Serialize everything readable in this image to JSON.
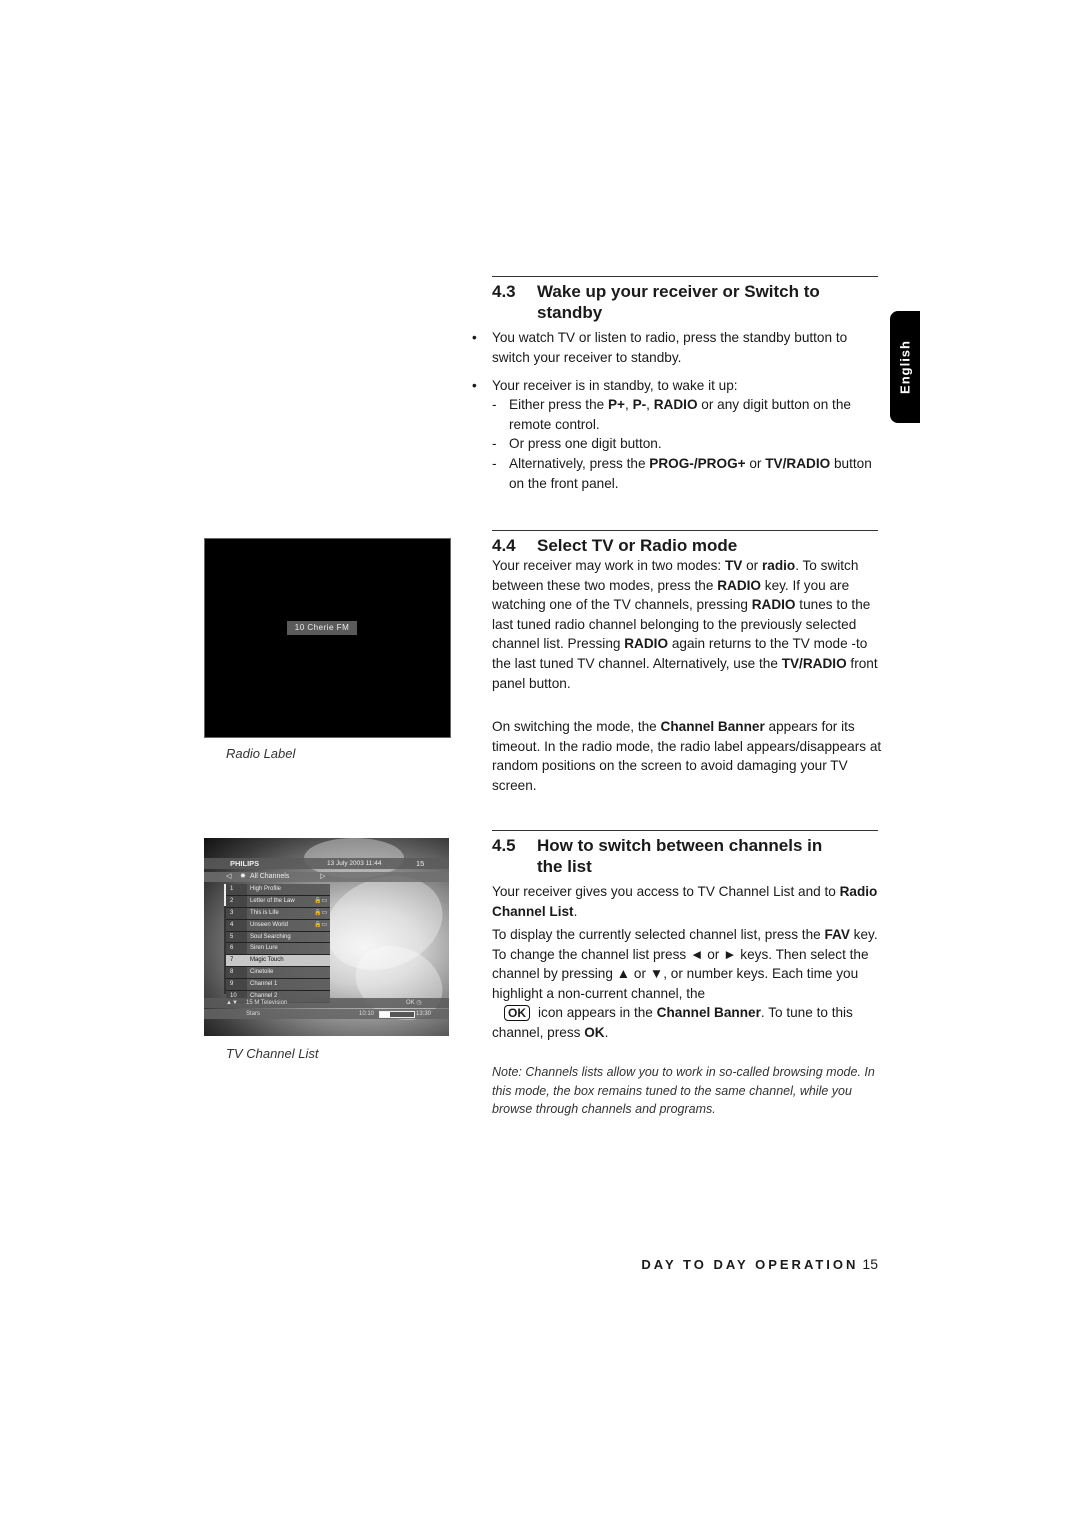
{
  "side_tab": {
    "language": "English"
  },
  "section_4_3": {
    "number": "4.3",
    "title_line1": "Wake up your receiver or Switch to",
    "title_line2": "standby",
    "bullet1": "You watch TV or listen to radio, press the standby button to switch your receiver to standby.",
    "bullet2": "Your receiver is in standby, to wake it up:",
    "dash1_pre": "Either press the ",
    "dash1_b1": "P+",
    "dash1_sep1": ", ",
    "dash1_b2": "P-",
    "dash1_sep2": ", ",
    "dash1_b3": "RADIO",
    "dash1_post": " or any digit button on the remote control.",
    "dash2": "Or press one digit button.",
    "dash3_pre": "Alternatively, press the ",
    "dash3_b1": "PROG-/PROG+",
    "dash3_mid": " or ",
    "dash3_b2": "TV/RADIO",
    "dash3_post": " button on the front panel."
  },
  "section_4_4": {
    "number": "4.4",
    "title": "Select TV or Radio mode",
    "p1_a": "Your receiver may work in two modes: ",
    "p1_b1": "TV",
    "p1_c": " or ",
    "p1_b2": "radio",
    "p1_d": ". To switch between these two modes, press the ",
    "p1_b3": "RADIO",
    "p1_e": " key. If you are watching one of the TV channels, pressing ",
    "p1_b4": "RADIO",
    "p1_f": " tunes to the last tuned radio channel belonging to the previously selected channel list. Pressing ",
    "p1_b5": "RADIO",
    "p1_g": " again returns to the TV mode -to the last tuned TV channel. Alternatively, use the ",
    "p1_b6": "TV/RADIO",
    "p1_h": " front panel button.",
    "p2_a": "On switching the mode, the ",
    "p2_b": "Channel Banner",
    "p2_c": " appears for its timeout. In the radio mode, the radio label appears/disappears at random positions on the screen to avoid damaging your TV screen."
  },
  "section_4_5": {
    "number": "4.5",
    "title_line1": "How to switch between channels in",
    "title_line2": "the list",
    "p1_a": "Your receiver gives you access to TV Channel List and to ",
    "p1_b": "Radio Channel List",
    "p1_c": ".",
    "p2_a": "To display the currently selected channel list, press the ",
    "p2_b1": "FAV",
    "p2_c": " key. To change the channel list press ◄  or ► keys. Then select the channel by pressing ▲ or ▼, or number keys. Each time you highlight a non-current channel, the",
    "ok_icon": "OK",
    "p2_d": "icon appears in the ",
    "p2_b2": "Channel Banner",
    "p2_e": ". To tune to this channel, press ",
    "p2_b3": "OK",
    "p2_f": ".",
    "note": "Note: Channels lists allow you to work in so-called browsing mode. In this mode, the box remains tuned to the same channel, while you browse through channels and programs."
  },
  "figures": {
    "radio": {
      "label_text": "10 Cherie FM",
      "caption": "Radio Label"
    },
    "tv_list": {
      "brand": "PHILIPS",
      "date_time": "13 July 2003   11:44",
      "channel_num": "15",
      "list_name": "All Channels",
      "arrow_left": "◁",
      "arrow_right": "▷",
      "channels": [
        {
          "num": "1",
          "name": "High Profile",
          "icons": ""
        },
        {
          "num": "2",
          "name": "Letter of the Law",
          "icons": "🔒▭"
        },
        {
          "num": "3",
          "name": "This is Life",
          "icons": "🔒▭"
        },
        {
          "num": "4",
          "name": "Unseen World",
          "icons": "🔒▭"
        },
        {
          "num": "5",
          "name": "Soul Searching",
          "icons": ""
        },
        {
          "num": "6",
          "name": "Siren Lure",
          "icons": ""
        },
        {
          "num": "7",
          "name": "Magic Touch",
          "icons": ""
        },
        {
          "num": "8",
          "name": "Cinetoile",
          "icons": ""
        },
        {
          "num": "9",
          "name": "Channel 1",
          "icons": ""
        },
        {
          "num": "10",
          "name": "Channel 2",
          "icons": ""
        }
      ],
      "selected_index": 6,
      "banner_channel": "15 M Television",
      "banner_icons": "OK ◷",
      "program": "Stars",
      "start_time": "10:10",
      "end_time": "13:30",
      "progress_fraction": 0.3,
      "caption": "TV Channel List"
    }
  },
  "footer": {
    "section": "DAY TO DAY OPERATION",
    "page": "15"
  }
}
